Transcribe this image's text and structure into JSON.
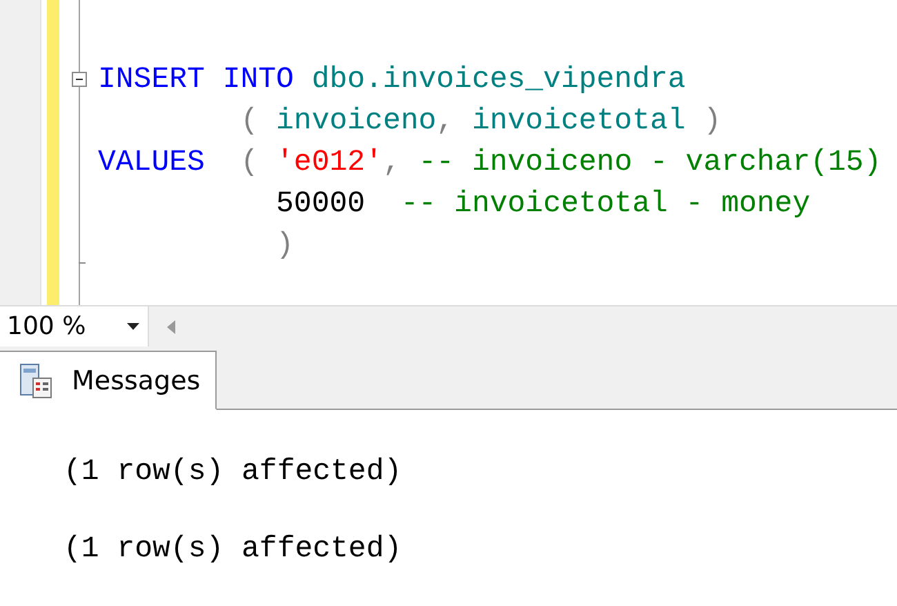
{
  "editor": {
    "lines": [
      {
        "collapsible": true,
        "tokens": [
          {
            "kind": "keyword",
            "text": "INSERT INTO "
          },
          {
            "kind": "identifier",
            "text": "dbo.invoices_vipendra"
          }
        ]
      },
      {
        "tokens": [
          {
            "kind": "operator",
            "text": "        ( "
          },
          {
            "kind": "identifier",
            "text": "invoiceno"
          },
          {
            "kind": "operator",
            "text": ", "
          },
          {
            "kind": "identifier",
            "text": "invoicetotal"
          },
          {
            "kind": "operator",
            "text": " )"
          }
        ]
      },
      {
        "tokens": [
          {
            "kind": "keyword",
            "text": "VALUES"
          },
          {
            "kind": "operator",
            "text": "  ( "
          },
          {
            "kind": "string",
            "text": "'e012'"
          },
          {
            "kind": "operator",
            "text": ", "
          },
          {
            "kind": "comment",
            "text": "-- invoiceno - varchar(15)"
          }
        ]
      },
      {
        "tokens": [
          {
            "kind": "plain",
            "text": "          50000"
          },
          {
            "kind": "comment",
            "text": "  -- invoicetotal - money"
          }
        ]
      },
      {
        "block_end": true,
        "tokens": [
          {
            "kind": "operator",
            "text": "          )"
          }
        ]
      }
    ]
  },
  "zoom": {
    "value": "100 %"
  },
  "tabs": [
    {
      "label": "Messages",
      "selected": true
    }
  ],
  "messages": [
    "(1 row(s) affected)",
    "(1 row(s) affected)"
  ]
}
